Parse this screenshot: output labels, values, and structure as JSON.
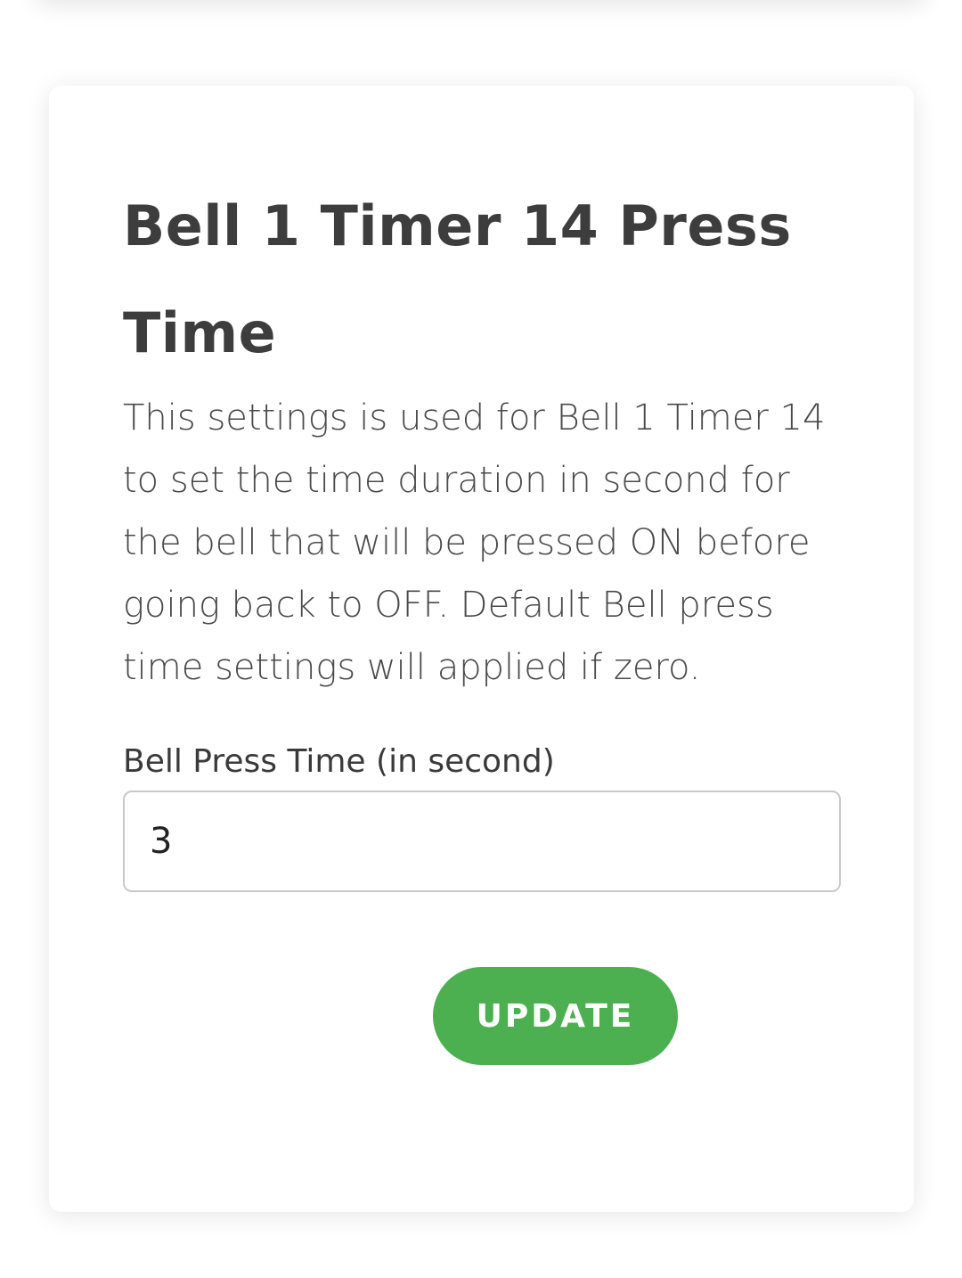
{
  "card": {
    "title": "Bell 1 Timer 14 Press Time",
    "description": "This settings is used for Bell 1 Timer 14 to set the time duration in second for the bell that will be pressed ON before going back to OFF. Default Bell press time settings will applied if zero."
  },
  "field": {
    "label": "Bell Press Time (in second)",
    "value": "3"
  },
  "actions": {
    "update_label": "UPDATE"
  },
  "colors": {
    "accent": "#4caf50",
    "text": "#3d3d3d"
  }
}
